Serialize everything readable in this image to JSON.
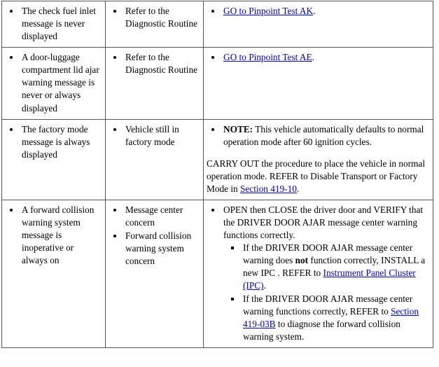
{
  "colors": {
    "link": "#0000cc",
    "border": "#555555",
    "text": "#000000",
    "background": "#ffffff"
  },
  "table": {
    "rows": [
      {
        "id": "row-check-fuel-inlet",
        "condition": [
          "The check fuel inlet message is never displayed"
        ],
        "possible_sources": [
          "Refer to the Diagnostic Routine"
        ],
        "action": {
          "type": "link-bullets",
          "bullets": [
            {
              "link_text": "GO to Pinpoint Test AK",
              "trailing": "."
            }
          ]
        }
      },
      {
        "id": "row-door-luggage-ajar",
        "condition": [
          "A door-luggage compartment lid ajar warning message is never or always displayed"
        ],
        "possible_sources": [
          "Refer to the Diagnostic Routine"
        ],
        "action": {
          "type": "link-bullets",
          "bullets": [
            {
              "link_text": "GO to Pinpoint Test AE",
              "trailing": "."
            }
          ]
        }
      },
      {
        "id": "row-factory-mode",
        "condition": [
          "The factory mode message is always displayed"
        ],
        "possible_sources": [
          "Vehicle still in factory mode"
        ],
        "action": {
          "type": "note",
          "note_label": "NOTE:",
          "note_text": " This vehicle automatically defaults to normal operation mode after 60 ignition cycles.",
          "paragraph_pre": "CARRY OUT the procedure to place the vehicle in normal operation mode. REFER to Disable Transport or Factory Mode in ",
          "paragraph_link": "Section 419-10",
          "paragraph_post": "."
        }
      },
      {
        "id": "row-forward-collision",
        "condition": [
          "A forward collision warning system message is inoperative or always on"
        ],
        "possible_sources": [
          "Message center concern",
          "Forward collision warning system concern"
        ],
        "action": {
          "type": "nested",
          "lead": "OPEN then CLOSE the driver door and VERIFY that the DRIVER DOOR AJAR message center warning functions correctly.",
          "sub_items": [
            {
              "pre": "If the DRIVER DOOR AJAR message center warning does ",
              "bold": "not",
              "mid": " function correctly, INSTALL a new IPC . REFER to ",
              "link": "Instrument Panel Cluster (IPC)",
              "post": "."
            },
            {
              "pre": "If the DRIVER DOOR AJAR message center warning functions correctly, REFER to ",
              "bold": "",
              "mid": "",
              "link": "Section 419-03B",
              "post": " to diagnose the forward collision warning system."
            }
          ]
        }
      }
    ]
  }
}
